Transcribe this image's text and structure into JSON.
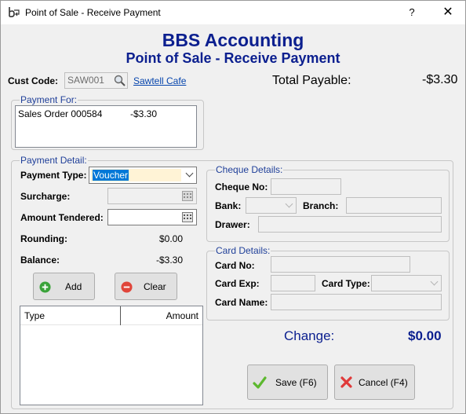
{
  "window": {
    "title": "Point of Sale - Receive Payment",
    "help": "?",
    "close": "✕"
  },
  "header": {
    "company": "BBS Accounting",
    "subtitle": "Point of Sale - Receive Payment"
  },
  "customer": {
    "label": "Cust Code:",
    "code": "SAW001",
    "name": "Sawtell Cafe"
  },
  "total_payable": {
    "label": "Total Payable:",
    "value": "-$3.30"
  },
  "payment_for": {
    "title": "Payment For:",
    "items": [
      {
        "desc": "Sales Order 000584",
        "amount": "-$3.30"
      }
    ]
  },
  "payment_detail": {
    "title": "Payment Detail:",
    "payment_type_label": "Payment Type:",
    "payment_type_value": "Voucher",
    "surcharge_label": "Surcharge:",
    "amount_tendered_label": "Amount Tendered:",
    "rounding_label": "Rounding:",
    "rounding_value": "$0.00",
    "balance_label": "Balance:",
    "balance_value": "-$3.30",
    "add_label": "Add",
    "clear_label": "Clear",
    "columns": {
      "type": "Type",
      "amount": "Amount"
    }
  },
  "cheque": {
    "title": "Cheque Details:",
    "no_label": "Cheque No:",
    "bank_label": "Bank:",
    "branch_label": "Branch:",
    "drawer_label": "Drawer:"
  },
  "card": {
    "title": "Card Details:",
    "no_label": "Card No:",
    "exp_label": "Card Exp:",
    "type_label": "Card Type:",
    "name_label": "Card Name:"
  },
  "change": {
    "label": "Change:",
    "value": "$0.00"
  },
  "actions": {
    "save": "Save (F6)",
    "cancel": "Cancel (F4)"
  },
  "colors": {
    "heading": "#0b1f8f",
    "group_title": "#1f3f99",
    "add_icon": "#3aa33a",
    "clear_icon": "#e0453a",
    "save_icon": "#5cb82e",
    "cancel_icon": "#e03a3a"
  }
}
